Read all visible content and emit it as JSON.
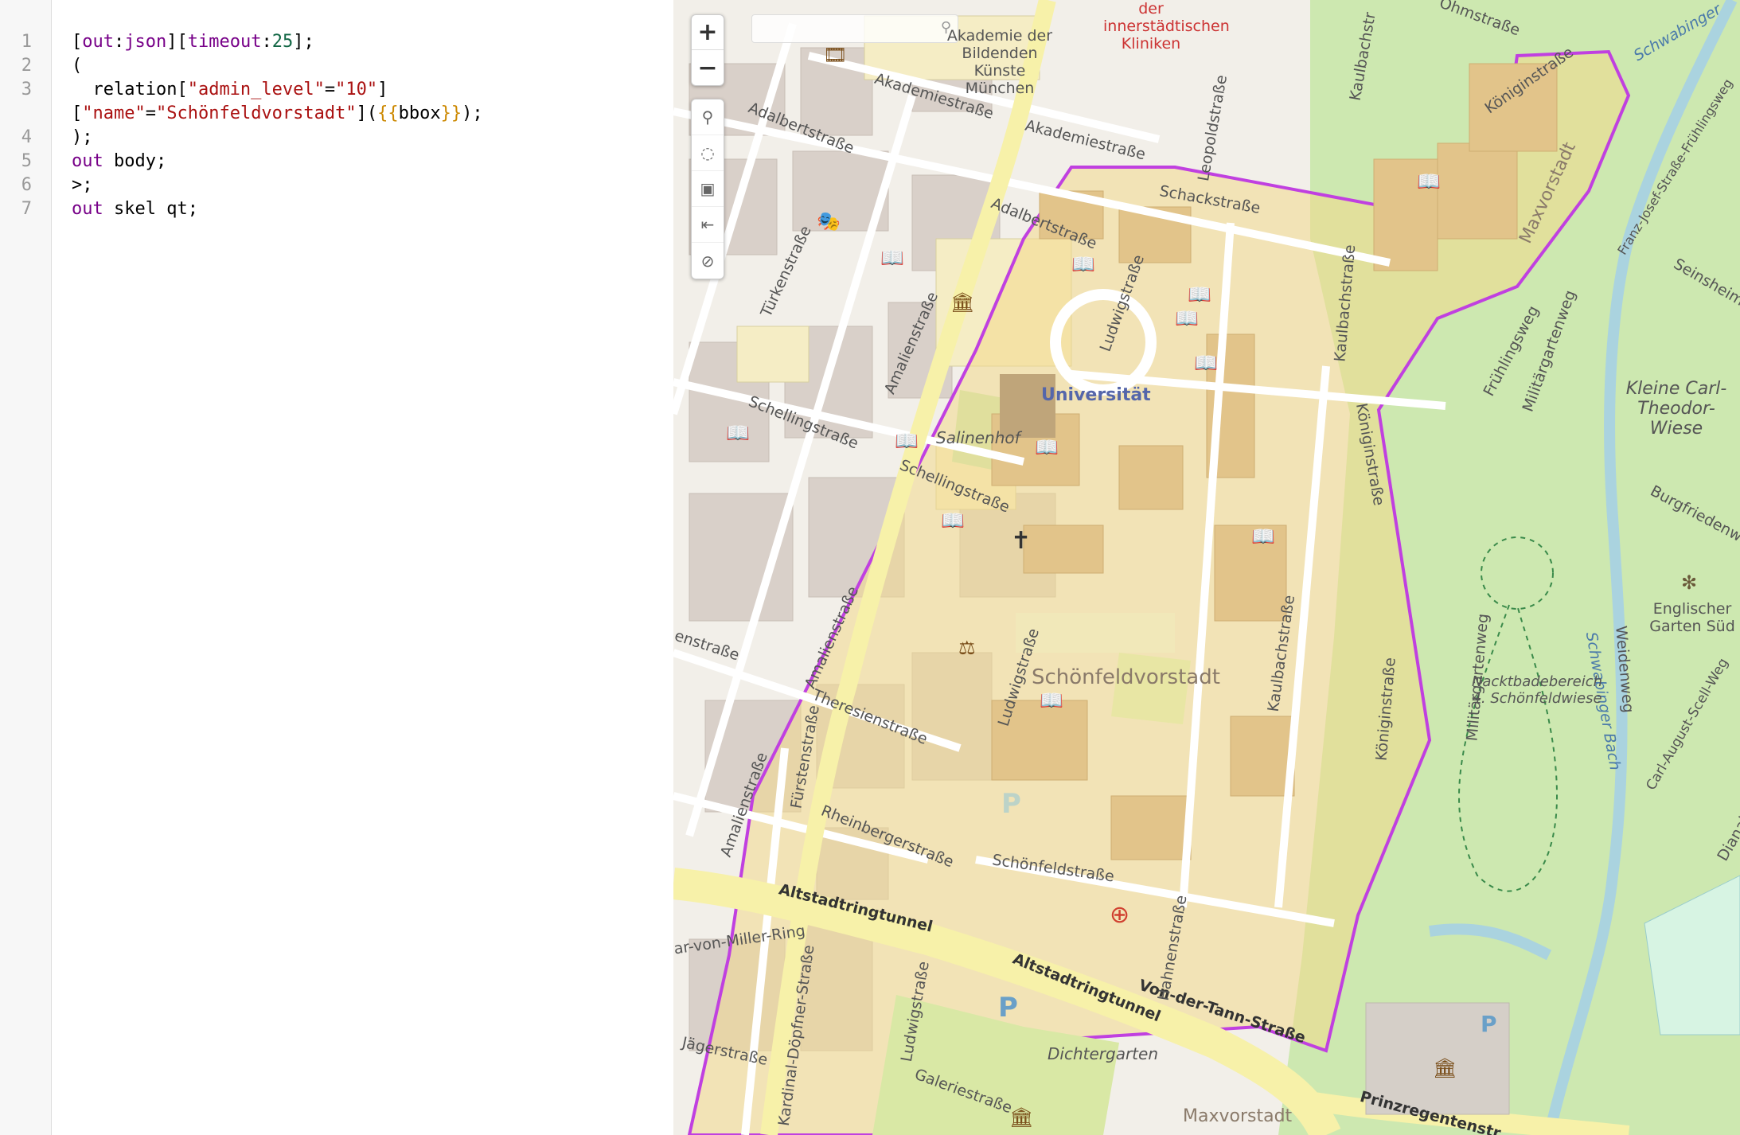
{
  "editor": {
    "line_numbers": [
      "1",
      "2",
      "",
      "3",
      "4",
      "5",
      "6",
      "7"
    ],
    "lines": {
      "l1": [
        "[",
        "out",
        ":",
        "json",
        "][",
        "timeout",
        ":",
        "25",
        "];"
      ],
      "l2": "(",
      "l3a": [
        "  relation[",
        "\"admin_level\"",
        "=",
        "\"10\"",
        "]"
      ],
      "l3b": [
        "[",
        "\"name\"",
        "=",
        "\"Schönfeldvorstadt\"",
        "](",
        "{{",
        "bbox",
        "}}",
        ");"
      ],
      "l4": ");",
      "l5": [
        "out",
        " body;"
      ],
      "l6": ">;",
      "l7": [
        "out",
        " skel qt;"
      ]
    }
  },
  "map": {
    "zoom_in": "+",
    "zoom_out": "−",
    "search_placeholder": "",
    "tools": [
      "search-icon",
      "locate-icon",
      "layers-icon",
      "back-icon",
      "disable-icon"
    ],
    "labels": {
      "klinik": "der innerstädtischen Kliniken",
      "akademie": "Akademie der Bildenden Künste München",
      "akademiestr1": "Akademiestraße",
      "akademiestr2": "Akademiestraße",
      "adalbertstr1": "Adalbertstraße",
      "adalbertstr2": "Adalbertstraße",
      "tuerkenstr": "Türkenstraße",
      "amalienstr1": "Amalienstraße",
      "amalienstr2": "Amalienstraße",
      "amalienstr3": "Amalienstraße",
      "schellingstr1": "Schellingstraße",
      "schellingstr2": "Schellingstraße",
      "salinenhof": "Salinenhof",
      "universitaet": "Universität",
      "ludwigstr1": "Ludwigstraße",
      "ludwigstr2": "Ludwigstraße",
      "ludwigstr3": "Ludwigstraße",
      "leopoldstr": "Leopoldstraße",
      "kaulbachstr1": "Kaulbachstraße",
      "kaulbachstr2": "Kaulbachstraße",
      "kaulbachstr3": "Kaulbachstraße",
      "schackstr": "Schackstraße",
      "koeniginstr1": "Königinstraße",
      "koeniginstr2": "Königinstraße",
      "koeniginstr3": "Königinstraße",
      "koeniginstr4": "Königinstraße",
      "maxvorstadt1": "Maxvorstadt",
      "maxvorstadt2": "Maxvorstadt",
      "schoenfeldvorstadt": "Schönfeldvorstadt",
      "theresienstr": "Theresienstraße",
      "fuerstenstr": "Fürstenstraße",
      "rheinbergerstr": "Rheinbergerstraße",
      "schoenfeldstr": "Schönfeldstraße",
      "altstadtringtunnel1": "Altstadtringtunnel",
      "altstadtringtunnel2": "Altstadtringtunnel",
      "vondertannstr": "Von-der-Tann-Straße",
      "oskarvonmillerring": "ar-von-Miller-Ring",
      "kardinaldoepfnerstr": "Kardinal-Döpfner-Straße",
      "jaegerstr": "Jägerstraße",
      "dichtergarten": "Dichtergarten",
      "galeriestr": "Galeriestraße",
      "hahnenstr": "Hahnenstraße",
      "prinzregentenstr": "Prinzregentenstr",
      "ohmstr": "Ohmstraße",
      "schwabinger": "Schwabinger",
      "schwabingerbach": "Schwabinger Bach",
      "fruehlingsweg": "Frühlingsweg",
      "franzjosefstr": "Franz-Josef-Straße-Frühlingsweg",
      "militaergartenweg1": "Militärgartenweg",
      "militaergartenweg2": "Militärgartenweg",
      "seinsheimstr": "Seinsheimstr",
      "kleinecarl": "Kleine Carl-Theodor-Wiese",
      "burgfriedenweg": "Burgfriedenweg",
      "englischergarten": "Englischer Garten Süd",
      "weidenweg": "Weidenweg",
      "nacktbade": "Nacktbadebereich 4. Schönfeldwiese",
      "carlaugust": "Carl-August-Scell-Weg",
      "diana": "Dianab",
      "enstr": "enstraße",
      "kaulbachstr_top": "Kaulbachstr",
      "ra": "Straße"
    }
  },
  "colors": {
    "highlight_fill": "#f3d98d",
    "highlight_border": "#c040e0",
    "park": "#cde8b0",
    "building": "#d9d0c9",
    "primary_road": "#f7f1a9",
    "keyword": "#770088",
    "string": "#aa1111",
    "number": "#116644"
  }
}
